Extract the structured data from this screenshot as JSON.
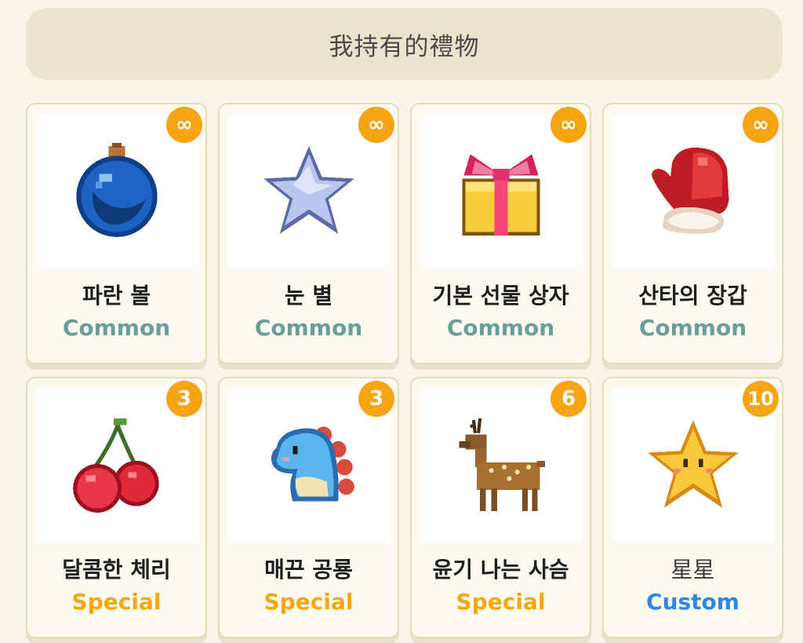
{
  "header": {
    "title": "我持有的禮物"
  },
  "rarity_colors": {
    "Common": "#6a9e9a",
    "Special": "#f3a712",
    "Custom": "#2f86e6"
  },
  "items": [
    {
      "name": "파란 볼",
      "rarity": "Common",
      "count": "∞",
      "icon": "blue-ornament-ball-icon"
    },
    {
      "name": "눈 별",
      "rarity": "Common",
      "count": "∞",
      "icon": "snow-star-icon"
    },
    {
      "name": "기본 선물 상자",
      "rarity": "Common",
      "count": "∞",
      "icon": "gift-box-icon"
    },
    {
      "name": "산타의 장갑",
      "rarity": "Common",
      "count": "∞",
      "icon": "santa-mitten-icon"
    },
    {
      "name": "달콤한 체리",
      "rarity": "Special",
      "count": "3",
      "icon": "cherry-icon"
    },
    {
      "name": "매끈 공룡",
      "rarity": "Special",
      "count": "3",
      "icon": "dinosaur-icon"
    },
    {
      "name": "윤기 나는 사슴",
      "rarity": "Special",
      "count": "6",
      "icon": "deer-icon"
    },
    {
      "name": "星星",
      "rarity": "Custom",
      "count": "10",
      "icon": "yellow-star-icon"
    }
  ]
}
